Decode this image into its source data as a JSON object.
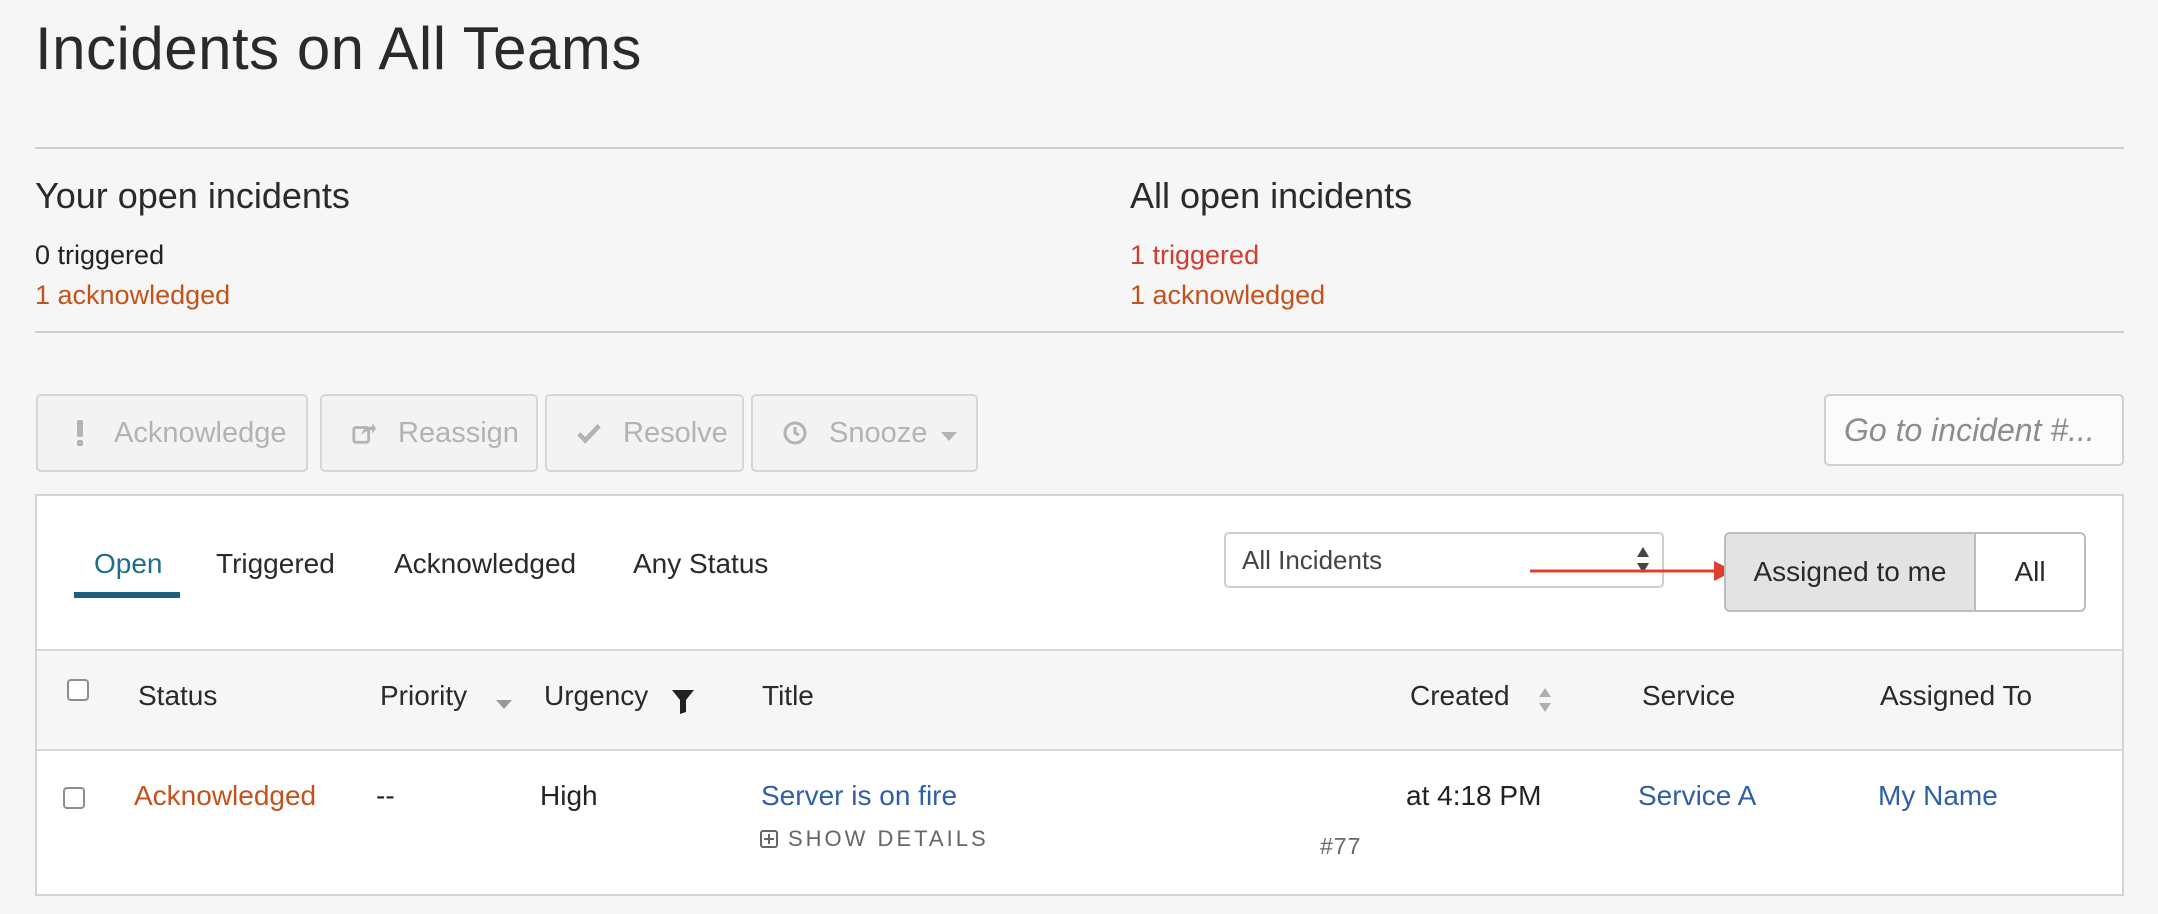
{
  "page": {
    "title": "Incidents on All Teams"
  },
  "summary": {
    "yours": {
      "heading": "Your open incidents",
      "triggered": "0 triggered",
      "acknowledged": "1 acknowledged"
    },
    "all": {
      "heading": "All open incidents",
      "triggered": "1 triggered",
      "acknowledged": "1 acknowledged"
    }
  },
  "toolbar": {
    "acknowledge": "Acknowledge",
    "reassign": "Reassign",
    "resolve": "Resolve",
    "snooze": "Snooze",
    "goto_placeholder": "Go to incident #..."
  },
  "tabs": [
    {
      "label": "Open",
      "active": true
    },
    {
      "label": "Triggered"
    },
    {
      "label": "Acknowledged"
    },
    {
      "label": "Any Status"
    }
  ],
  "filter": {
    "selected": "All Incidents",
    "assigned_to_me": "Assigned to me",
    "all": "All"
  },
  "colors": {
    "accent": "#1e5f7a",
    "triggered": "#d13d2f",
    "acknowledged": "#c4521c",
    "link": "#2f5fa8",
    "arrow": "#e0402b"
  },
  "table": {
    "columns": {
      "status": "Status",
      "priority": "Priority",
      "urgency": "Urgency",
      "title": "Title",
      "created": "Created",
      "service": "Service",
      "assigned_to": "Assigned To"
    },
    "rows": [
      {
        "status": "Acknowledged",
        "priority": "--",
        "urgency": "High",
        "title": "Server is on fire",
        "details": "SHOW DETAILS",
        "number": "#77",
        "created": "at 4:18 PM",
        "service": "Service A",
        "assigned_to": "My Name"
      }
    ]
  }
}
